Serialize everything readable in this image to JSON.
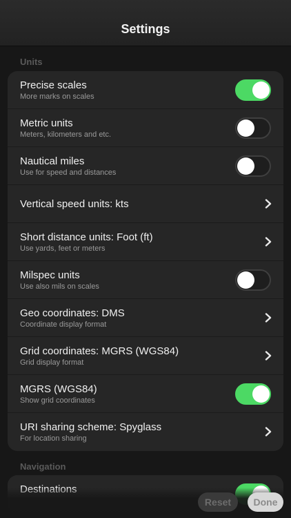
{
  "nav": {
    "title": "Settings"
  },
  "sections": {
    "units": {
      "header": "Units",
      "precise_scales": {
        "title": "Precise scales",
        "subtitle": "More marks on scales",
        "on": true
      },
      "metric_units": {
        "title": "Metric units",
        "subtitle": "Meters, kilometers and etc.",
        "on": false
      },
      "nautical_miles": {
        "title": "Nautical miles",
        "subtitle": "Use for speed and distances",
        "on": false
      },
      "vertical_speed": {
        "title": "Vertical speed units: kts"
      },
      "short_distance": {
        "title": "Short distance units: Foot (ft)",
        "subtitle": "Use yards, feet or meters"
      },
      "milspec_units": {
        "title": "Milspec units",
        "subtitle": "Use also mils on scales",
        "on": false
      },
      "geo_coordinates": {
        "title": "Geo coordinates: DMS",
        "subtitle": "Coordinate display format"
      },
      "grid_coordinates": {
        "title": "Grid coordinates: MGRS (WGS84)",
        "subtitle": "Grid display format"
      },
      "mgrs": {
        "title": "MGRS (WGS84)",
        "subtitle": "Show grid coordinates",
        "on": true
      },
      "uri_sharing": {
        "title": "URI sharing scheme: Spyglass",
        "subtitle": "For location sharing"
      }
    },
    "navigation": {
      "header": "Navigation",
      "destinations": {
        "title": "Destinations",
        "on": true
      }
    }
  },
  "bottom": {
    "reset_label": "Reset",
    "done_label": "Done"
  },
  "colors": {
    "toggle_on": "#4cd964",
    "background": "#171717",
    "group": "#262626"
  },
  "icons": {
    "disclosure": "chevron-right-icon"
  }
}
